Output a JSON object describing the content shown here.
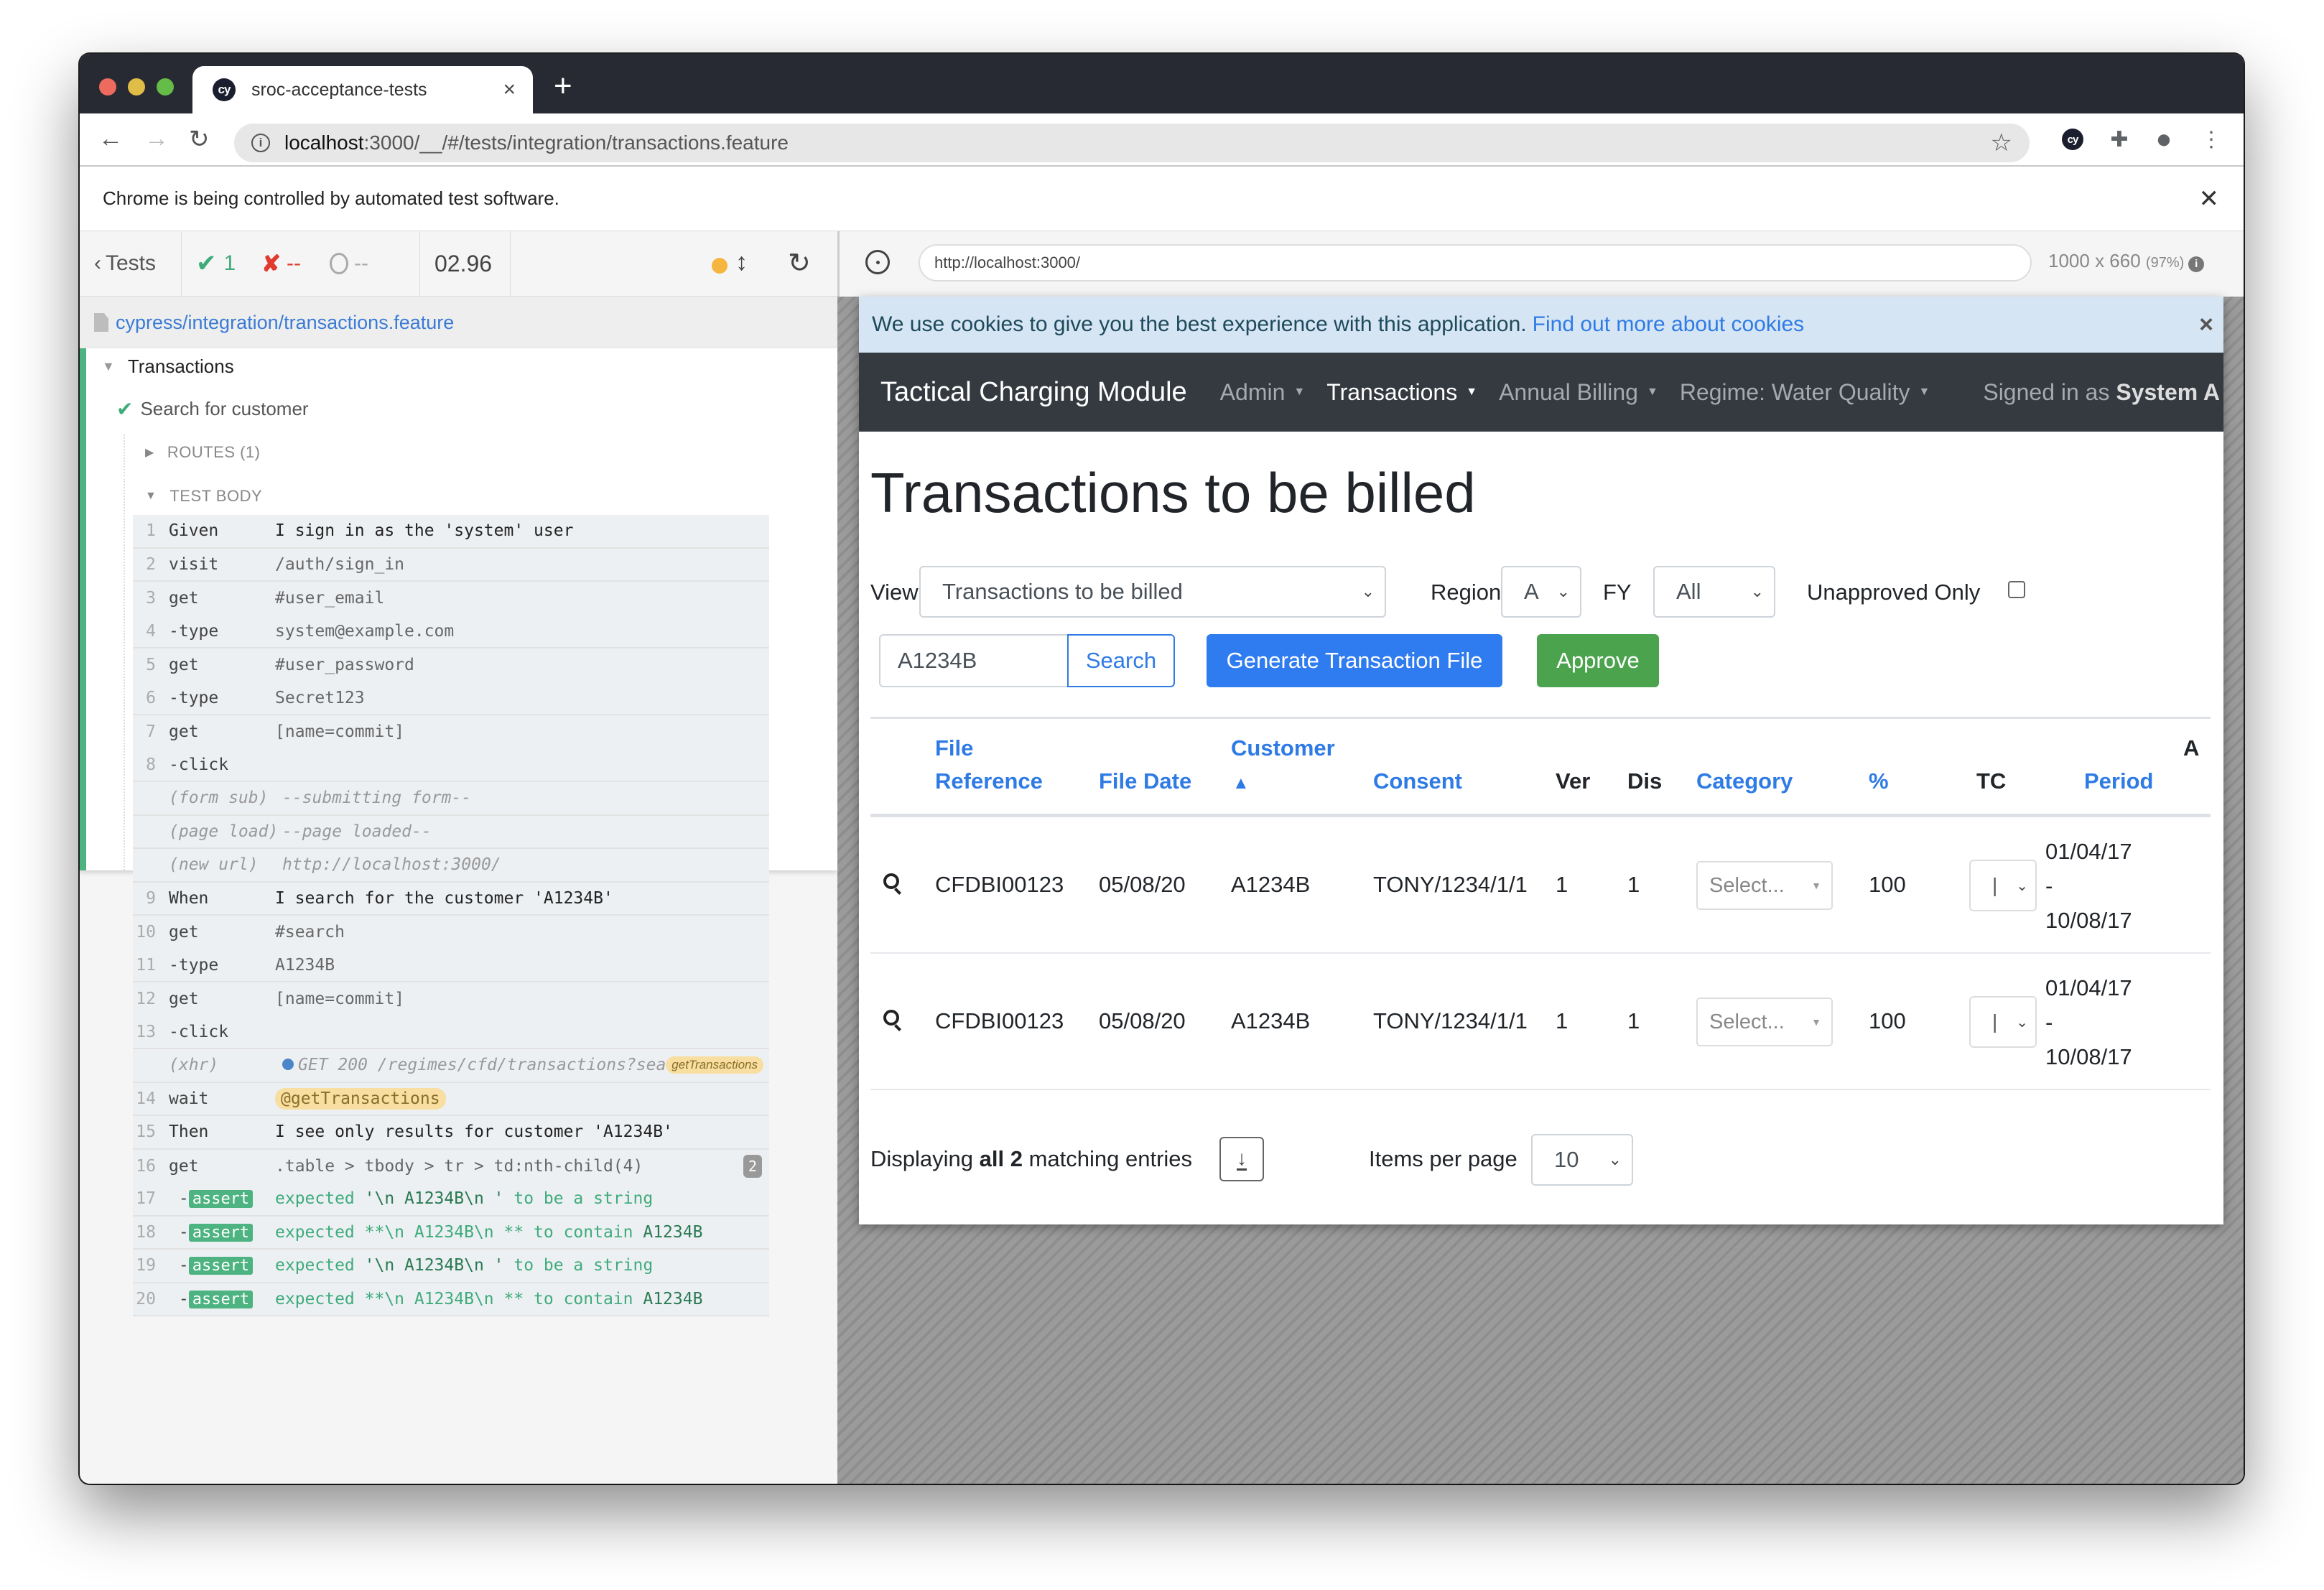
{
  "browser": {
    "tab_title": "sroc-acceptance-tests",
    "tab_close": "×",
    "new_tab": "+",
    "url_host": "localhost",
    "url_path": ":3000/__/#/tests/integration/transactions.feature",
    "automation_notice": "Chrome is being controlled by automated test software.",
    "automation_close": "✕",
    "extension_label": "cy"
  },
  "reporter": {
    "back_label": "Tests",
    "passed": "1",
    "failed": "--",
    "pending": "--",
    "duration": "02.96",
    "spec_path": "cypress/integration/transactions.feature",
    "suite": "Transactions",
    "test": "Search for customer",
    "routes": "ROUTES (1)",
    "test_body": "TEST BODY",
    "commands": [
      {
        "num": "1",
        "name": "Given",
        "msg": "I sign in as the 'system' user",
        "type": "bdd"
      },
      {
        "num": "2",
        "name": "visit",
        "msg": "/auth/sign_in",
        "type": "cmd"
      },
      {
        "num": "3",
        "name": "get",
        "msg": "#user_email",
        "type": "cmd",
        "nob": true
      },
      {
        "num": "4",
        "name": " -type",
        "msg": "system@example.com",
        "type": "cmd"
      },
      {
        "num": "5",
        "name": "get",
        "msg": "#user_password",
        "type": "cmd",
        "nob": true
      },
      {
        "num": "6",
        "name": " -type",
        "msg": "Secret123",
        "type": "cmd"
      },
      {
        "num": "7",
        "name": "get",
        "msg": "[name=commit]",
        "type": "cmd",
        "nob": true
      },
      {
        "num": "8",
        "name": " -click",
        "msg": "",
        "type": "cmd"
      },
      {
        "num": "",
        "name": "(form sub)",
        "msg": "--submitting form--",
        "type": "event"
      },
      {
        "num": "",
        "name": "(page load)",
        "msg": "--page loaded--",
        "type": "event"
      },
      {
        "num": "",
        "name": "(new url)",
        "msg": "http://localhost:3000/",
        "type": "event"
      },
      {
        "num": "9",
        "name": "When",
        "msg": "I search for the customer 'A1234B'",
        "type": "bdd"
      },
      {
        "num": "10",
        "name": "get",
        "msg": "#search",
        "type": "cmd",
        "nob": true
      },
      {
        "num": "11",
        "name": " -type",
        "msg": "A1234B",
        "type": "cmd"
      },
      {
        "num": "12",
        "name": "get",
        "msg": "[name=commit]",
        "type": "cmd",
        "nob": true
      },
      {
        "num": "13",
        "name": " -click",
        "msg": "",
        "type": "cmd"
      },
      {
        "num": "",
        "name": "(xhr)",
        "msg": "GET 200 /regimes/cfd/transactions?sea...",
        "type": "xhr",
        "alias": "getTransactions"
      },
      {
        "num": "14",
        "name": "wait",
        "msg": "@getTransactions",
        "type": "wait"
      },
      {
        "num": "15",
        "name": "Then",
        "msg": "I see only results for customer 'A1234B'",
        "type": "bdd"
      },
      {
        "num": "16",
        "name": "get",
        "msg": ".table > tbody > tr > td:nth-child(4)",
        "type": "cmd",
        "count": "2",
        "nob": true
      },
      {
        "num": "17",
        "name": "assert",
        "pre": "expected ",
        "b": "'\\n A1234B\\n  '",
        "post": " to be a string",
        "type": "assert"
      },
      {
        "num": "18",
        "name": "assert",
        "pre": "expected **\\n A1234B\\n ** to contain ",
        "b": "A1234B",
        "post": "",
        "type": "assert"
      },
      {
        "num": "19",
        "name": "assert",
        "pre": "expected ",
        "b": "'\\n A1234B\\n  '",
        "post": " to be a string",
        "type": "assert"
      },
      {
        "num": "20",
        "name": "assert",
        "pre": "expected **\\n A1234B\\n ** to contain ",
        "b": "A1234B",
        "post": "",
        "type": "assert"
      }
    ]
  },
  "aut": {
    "url": "http://localhost:3000/",
    "viewport": "1000 x 660",
    "scale": "(97%)"
  },
  "app": {
    "cookie_text": "We use cookies to give you the best experience with this application.",
    "cookie_link": "Find out more about cookies",
    "cookie_close": "×",
    "brand": "Tactical Charging Module",
    "nav": [
      {
        "label": "Admin",
        "active": false
      },
      {
        "label": "Transactions",
        "active": true
      },
      {
        "label": "Annual Billing",
        "active": false
      },
      {
        "label": "Regime: Water Quality",
        "active": false
      }
    ],
    "signed_in_prefix": "Signed in as",
    "signed_in_user": "System A",
    "page_title": "Transactions to be billed",
    "filters": {
      "view_label": "View",
      "view_value": "Transactions to be billed",
      "region_label": "Region",
      "region_value": "A",
      "fy_label": "FY",
      "fy_value": "All",
      "unapproved_label": "Unapproved Only",
      "unapproved_checked": false
    },
    "search_value": "A1234B",
    "search_button": "Search",
    "generate_button": "Generate Transaction File",
    "approve_button": "Approve",
    "table": {
      "headers": {
        "file_ref_1": "File",
        "file_ref_2": "Reference",
        "file_date": "File Date",
        "customer": "Customer",
        "sort_indicator": "▲",
        "consent": "Consent",
        "ver": "Ver",
        "dis": "Dis",
        "category": "Category",
        "percent": "%",
        "tc": "TC",
        "period": "Period",
        "amount_partial": "A"
      },
      "rows": [
        {
          "file_reference": "CFDBI00123",
          "file_date": "05/08/20",
          "customer": "A1234B",
          "consent": "TONY/1234/1/1",
          "ver": "1",
          "dis": "1",
          "category": "Select...",
          "percent": "100",
          "tc": "|",
          "period_start": "01/04/17",
          "period_sep": "-",
          "period_end": "10/08/17"
        },
        {
          "file_reference": "CFDBI00123",
          "file_date": "05/08/20",
          "customer": "A1234B",
          "consent": "TONY/1234/1/1",
          "ver": "1",
          "dis": "1",
          "category": "Select...",
          "percent": "100",
          "tc": "|",
          "period_start": "01/04/17",
          "period_sep": "-",
          "period_end": "10/08/17"
        }
      ]
    },
    "footer": {
      "displaying_prefix": "Displaying",
      "displaying_bold": "all 2",
      "displaying_suffix": "matching entries",
      "items_per_page_label": "Items per page",
      "items_per_page_value": "10"
    }
  },
  "colors": {
    "pass": "#3eab7b",
    "fail": "#e03b2e",
    "link": "#2f7be5",
    "approve": "#4ca34e",
    "navbar": "#343a40"
  }
}
